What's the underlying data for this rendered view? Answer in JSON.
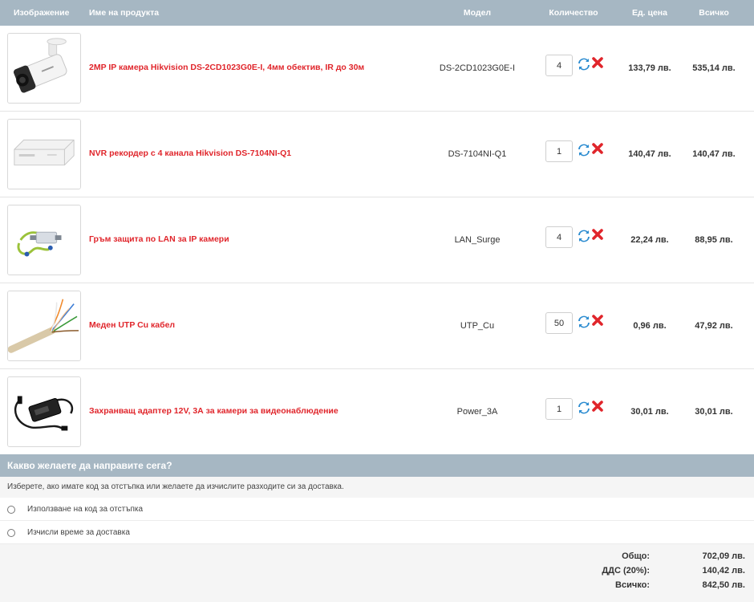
{
  "table": {
    "headers": {
      "image": "Изображение",
      "name": "Име на продукта",
      "model": "Модел",
      "quantity": "Количество",
      "unit_price": "Ед. цена",
      "total": "Всичко"
    },
    "items": [
      {
        "name": "2MP IP камера Hikvision DS-2CD1023G0E-I, 4мм обектив, IR до 30м",
        "model": "DS-2CD1023G0E-I",
        "quantity": "4",
        "unit_price": "133,79 лв.",
        "total": "535,14 лв.",
        "image_icon": "bullet-camera-image"
      },
      {
        "name": "NVR рекордер с 4 канала Hikvision DS-7104NI-Q1",
        "model": "DS-7104NI-Q1",
        "quantity": "1",
        "unit_price": "140,47 лв.",
        "total": "140,47 лв.",
        "image_icon": "nvr-recorder-image"
      },
      {
        "name": "Гръм защита по LAN за IP камери",
        "model": "LAN_Surge",
        "quantity": "4",
        "unit_price": "22,24 лв.",
        "total": "88,95 лв.",
        "image_icon": "surge-protector-image"
      },
      {
        "name": "Меден UTP Cu кабел",
        "model": "UTP_Cu",
        "quantity": "50",
        "unit_price": "0,96 лв.",
        "total": "47,92 лв.",
        "image_icon": "utp-cable-image"
      },
      {
        "name": "Захранващ адаптер 12V, 3А за камери за видеонаблюдение",
        "model": "Power_3A",
        "quantity": "1",
        "unit_price": "30,01 лв.",
        "total": "30,01 лв.",
        "image_icon": "power-adapter-image"
      }
    ]
  },
  "next_steps": {
    "heading": "Какво желаете да направите сега?",
    "description": "Изберете, ако имате код за отстъпка или желаете да изчислите разходите си за доставка.",
    "options": [
      {
        "label": "Използване на код за отстъпка"
      },
      {
        "label": "Изчисли време за доставка"
      }
    ]
  },
  "totals": [
    {
      "label": "Общо:",
      "value": "702,09 лв."
    },
    {
      "label": "ДДС (20%):",
      "value": "140,42 лв."
    },
    {
      "label": "Всичко:",
      "value": "842,50 лв."
    }
  ],
  "colors": {
    "header_bg": "#a6b7c3",
    "product_link": "#e0252b",
    "refresh_icon": "#2a8bd0",
    "remove_icon": "#e0252b"
  }
}
